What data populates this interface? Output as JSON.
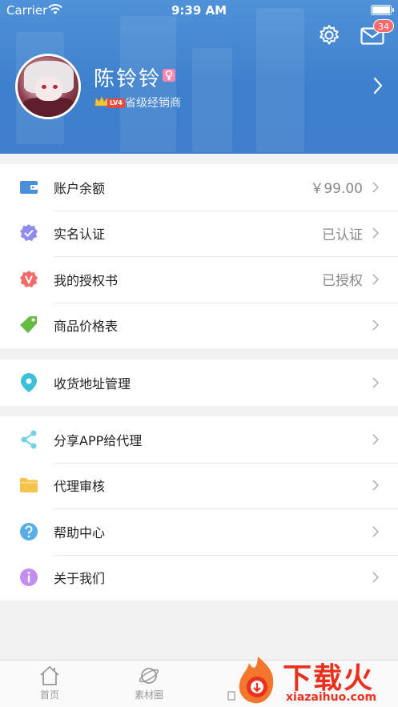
{
  "status_bar": {
    "carrier": "Carrier",
    "time": "9:39 AM"
  },
  "header": {
    "message_badge": "34",
    "user_name": "陈铃铃",
    "level": "LV4",
    "role": "省级经销商"
  },
  "colors": {
    "header_bg": "#4287d3",
    "accent_red": "#ff6a6a",
    "text_primary": "#222222",
    "text_secondary": "#888888"
  },
  "groups": [
    {
      "items": [
        {
          "label": "账户余额",
          "value": "￥99.00",
          "icon": "wallet-icon",
          "icon_color": "#4a90d9"
        },
        {
          "label": "实名认证",
          "value": "已认证",
          "icon": "verified-badge-icon",
          "icon_color": "#8f8cf0"
        },
        {
          "label": "我的授权书",
          "value": "已授权",
          "icon": "authorization-icon",
          "icon_color": "#f26b6b"
        },
        {
          "label": "商品价格表",
          "value": "",
          "icon": "price-tag-icon",
          "icon_color": "#66bb44"
        }
      ]
    },
    {
      "items": [
        {
          "label": "收货地址管理",
          "value": "",
          "icon": "location-pin-icon",
          "icon_color": "#3cbfd8"
        }
      ]
    },
    {
      "items": [
        {
          "label": "分享APP给代理",
          "value": "",
          "icon": "share-icon",
          "icon_color": "#6fd3e0"
        },
        {
          "label": "代理审核",
          "value": "",
          "icon": "folder-icon",
          "icon_color": "#f5c24c"
        },
        {
          "label": "帮助中心",
          "value": "",
          "icon": "help-icon",
          "icon_color": "#5aaee8"
        },
        {
          "label": "关于我们",
          "value": "",
          "icon": "info-icon",
          "icon_color": "#c38df0"
        }
      ]
    }
  ],
  "tabbar": {
    "tabs": [
      {
        "label": "首页",
        "icon": "home-icon"
      },
      {
        "label": "素材圈",
        "icon": "planet-icon"
      }
    ],
    "watermark_text": "下载火",
    "watermark_url": "xiazaihuo.com"
  }
}
